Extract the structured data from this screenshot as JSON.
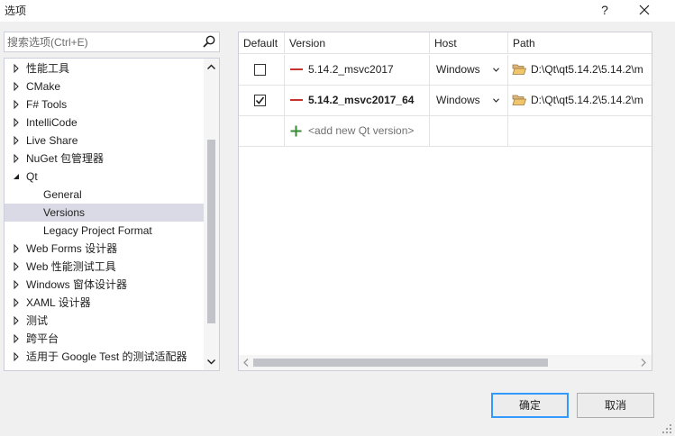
{
  "window": {
    "title": "选项",
    "help_glyph": "?",
    "close_glyph": "✕"
  },
  "search": {
    "placeholder": "搜索选项(Ctrl+E)",
    "value": ""
  },
  "tree": {
    "items": [
      {
        "label": "性能工具",
        "expander": "collapsed",
        "level": 0
      },
      {
        "label": "CMake",
        "expander": "collapsed",
        "level": 0
      },
      {
        "label": "F# Tools",
        "expander": "collapsed",
        "level": 0
      },
      {
        "label": "IntelliCode",
        "expander": "collapsed",
        "level": 0
      },
      {
        "label": "Live Share",
        "expander": "collapsed",
        "level": 0
      },
      {
        "label": "NuGet 包管理器",
        "expander": "collapsed",
        "level": 0
      },
      {
        "label": "Qt",
        "expander": "expanded",
        "level": 0
      },
      {
        "label": "General",
        "expander": "none",
        "level": 1
      },
      {
        "label": "Versions",
        "expander": "none",
        "level": 1,
        "selected": true
      },
      {
        "label": "Legacy Project Format",
        "expander": "none",
        "level": 1
      },
      {
        "label": "Web Forms 设计器",
        "expander": "collapsed",
        "level": 0
      },
      {
        "label": "Web 性能测试工具",
        "expander": "collapsed",
        "level": 0
      },
      {
        "label": "Windows 窗体设计器",
        "expander": "collapsed",
        "level": 0
      },
      {
        "label": "XAML 设计器",
        "expander": "collapsed",
        "level": 0
      },
      {
        "label": "测试",
        "expander": "collapsed",
        "level": 0
      },
      {
        "label": "跨平台",
        "expander": "collapsed",
        "level": 0
      },
      {
        "label": "适用于 Google Test 的测试适配器",
        "expander": "collapsed",
        "level": 0
      }
    ]
  },
  "grid": {
    "columns": [
      "Default",
      "Version",
      "Host",
      "Path"
    ],
    "rows": [
      {
        "default": false,
        "version": "5.14.2_msvc2017",
        "bold": false,
        "host": "Windows",
        "path": "D:\\Qt\\qt5.14.2\\5.14.2\\m"
      },
      {
        "default": true,
        "version": "5.14.2_msvc2017_64",
        "bold": true,
        "host": "Windows",
        "path": "D:\\Qt\\qt5.14.2\\5.14.2\\m"
      }
    ],
    "add_row": {
      "label": "<add new Qt version>"
    }
  },
  "buttons": {
    "ok": "确定",
    "cancel": "取消"
  },
  "colors": {
    "selection": "#dadae6",
    "version_dash": "#c4342c",
    "add_plus": "#388a34",
    "ok_border": "#3399ff"
  }
}
